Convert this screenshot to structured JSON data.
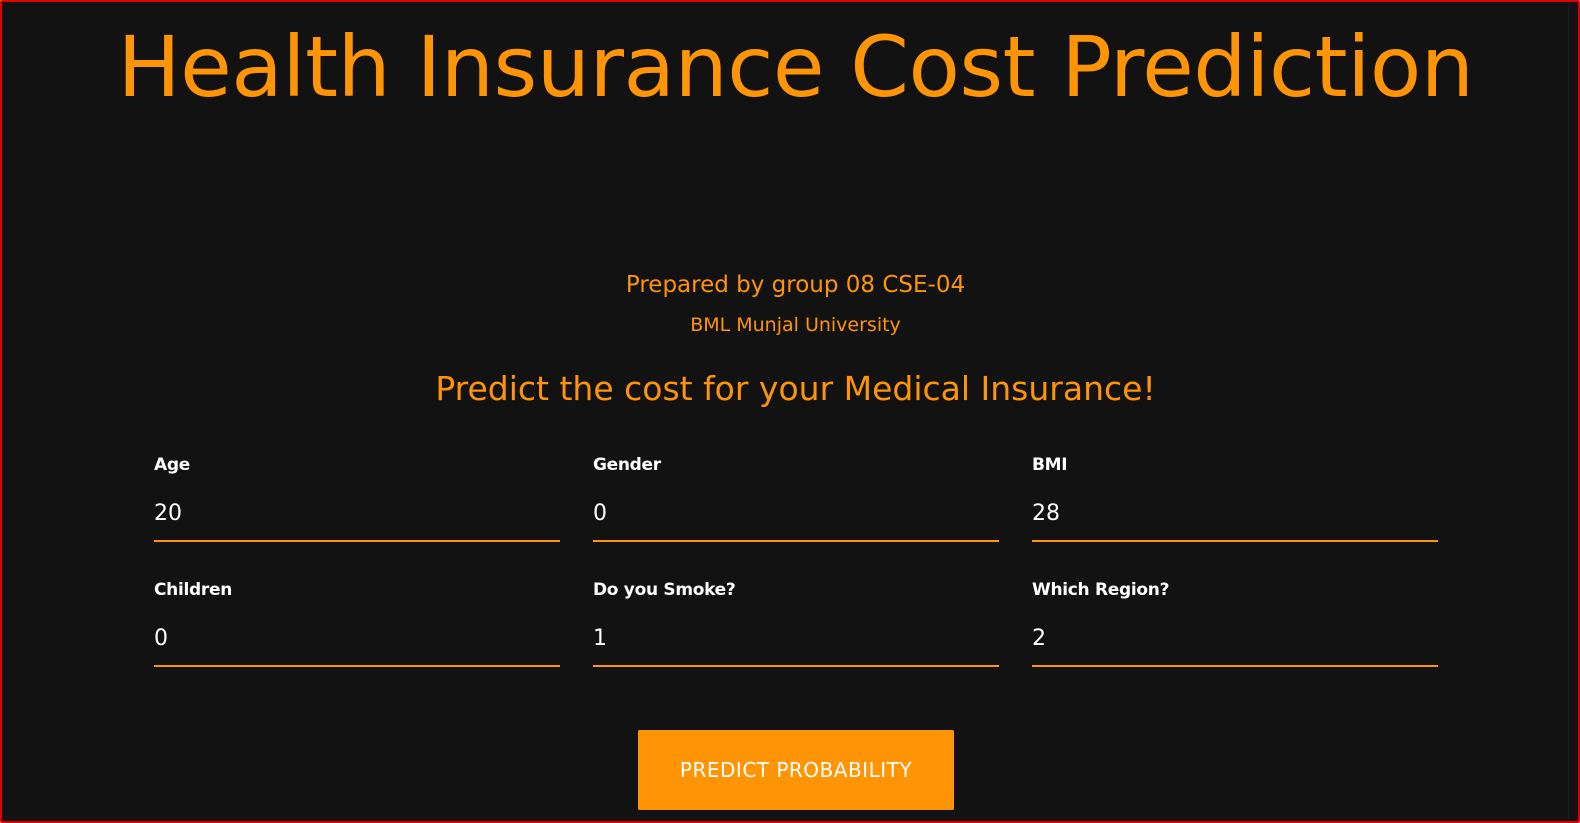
{
  "header": {
    "title": "Health Insurance Cost Prediction",
    "prepared_by": "Prepared by group 08 CSE-04",
    "university": "BML Munjal University"
  },
  "form": {
    "heading": "Predict the cost for your Medical Insurance!",
    "fields": [
      {
        "label": "Age",
        "value": "20"
      },
      {
        "label": "Gender",
        "value": "0"
      },
      {
        "label": "BMI",
        "value": "28"
      },
      {
        "label": "Children",
        "value": "0"
      },
      {
        "label": "Do you Smoke?",
        "value": "1"
      },
      {
        "label": "Which Region?",
        "value": "2"
      }
    ],
    "submit_label": "PREDICT PROBABILITY"
  },
  "colors": {
    "accent": "#ff9505",
    "background": "#121212",
    "text": "#ffffff",
    "frame_border": "#e00000"
  }
}
